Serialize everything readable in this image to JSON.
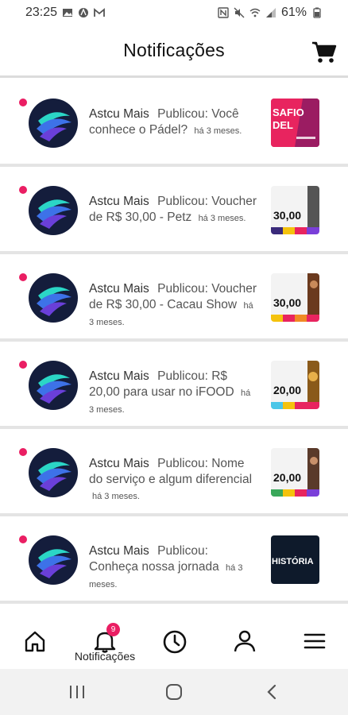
{
  "status_bar": {
    "time": "23:25",
    "battery": "61%",
    "left_icons": [
      "image-icon",
      "a-circle-icon",
      "gmail-icon"
    ],
    "right_icons": [
      "nfc-icon",
      "mute-icon",
      "wifi-icon",
      "signal-icon",
      "battery-icon"
    ]
  },
  "header": {
    "title": "Notificações",
    "cart_icon": "cart-icon"
  },
  "notifications": [
    {
      "author": "Astcu Mais",
      "text": "Publicou: Você conhece o Pádel?",
      "time": "há 3 meses.",
      "thumb_text": "SAFIO\nDEL",
      "thumb_bg": "#e8245f"
    },
    {
      "author": "Astcu Mais",
      "text": "Publicou: Voucher de R$ 30,00 - Petz",
      "time": "há 3 meses.",
      "thumb_text": "30,00",
      "thumb_bg": "#f3f3f3"
    },
    {
      "author": "Astcu Mais",
      "text": "Publicou: Voucher de R$ 30,00 - Cacau Show",
      "time": "há 3 meses.",
      "thumb_text": "30,00",
      "thumb_bg": "#f3f3f3"
    },
    {
      "author": "Astcu Mais",
      "text": "Publicou: R$ 20,00 para usar no iFOOD",
      "time": "há 3 meses.",
      "thumb_text": "20,00",
      "thumb_bg": "#f3f3f3"
    },
    {
      "author": "Astcu Mais",
      "text": "Publicou: Nome do serviço e algum diferencial",
      "time": "há 3 meses.",
      "thumb_text": "20,00",
      "thumb_bg": "#f3f3f3"
    },
    {
      "author": "Astcu Mais",
      "text": "Publicou: Conheça nossa jornada",
      "time": "há 3 meses.",
      "thumb_text": "HISTÓRIA",
      "thumb_bg": "#0e1a2b"
    }
  ],
  "bottom_nav": {
    "items": [
      "home-icon",
      "bell-icon",
      "clock-icon",
      "user-icon",
      "menu-icon"
    ],
    "active_label": "Notificações",
    "badge": "9"
  },
  "system_nav": [
    "recents-icon",
    "home-circle-icon",
    "back-icon"
  ],
  "colors": {
    "accent": "#ea1e63",
    "avatar_bg": "#141d3c",
    "divider": "#e4e4e4"
  }
}
